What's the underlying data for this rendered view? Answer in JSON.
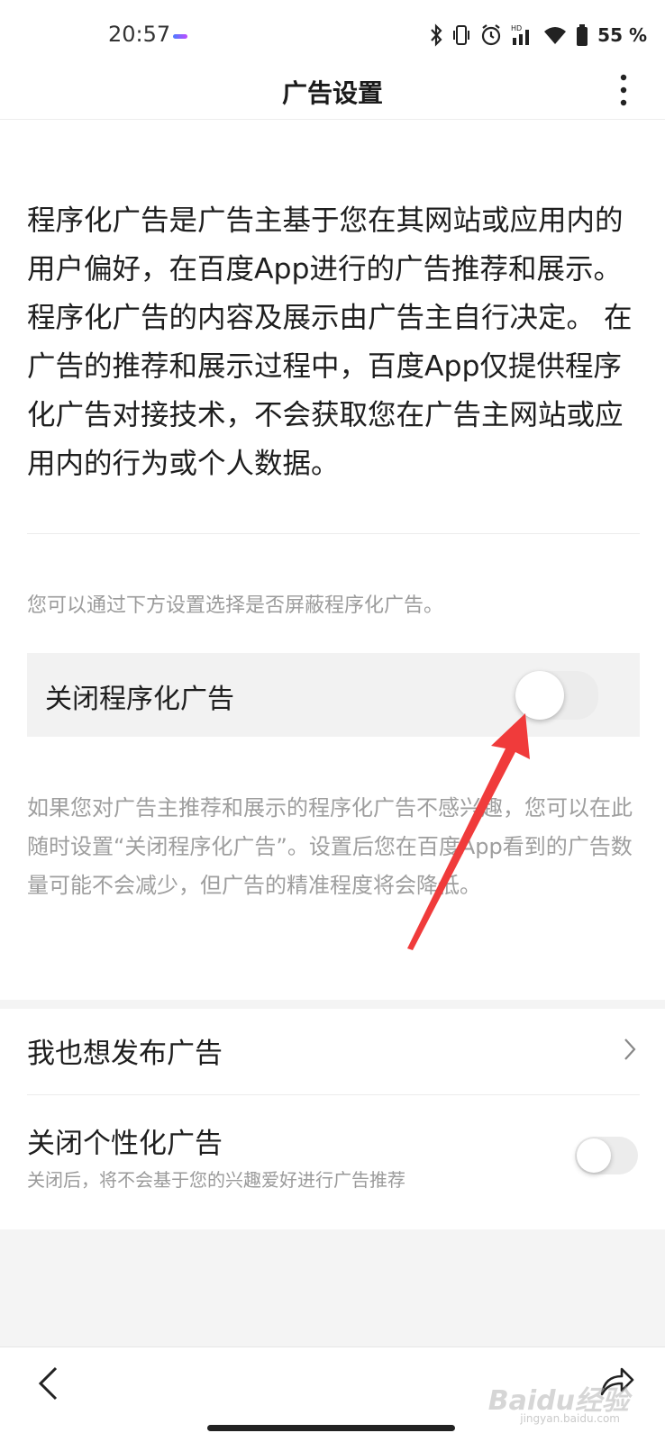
{
  "status_bar": {
    "time": "20:57",
    "battery": "55 %",
    "icons": [
      "bluetooth-icon",
      "vibrate-icon",
      "alarm-icon",
      "hd-signal-icon",
      "wifi-icon",
      "battery-icon"
    ]
  },
  "nav": {
    "title": "广告设置",
    "more_icon": "more-vertical-icon"
  },
  "intro_text": "程序化广告是广告主基于您在其网站或应用内的用户偏好，在百度App进行的广告推荐和展示。程序化广告的内容及展示由广告主自行决定。 在广告的推荐和展示过程中，百度App仅提供程序化广告对接技术，不会获取您在广告主网站或应用内的行为或个人数据。",
  "hint_text": "您可以通过下方设置选择是否屏蔽程序化广告。",
  "programmatic_toggle": {
    "label": "关闭程序化广告",
    "on": false
  },
  "description": "如果您对广告主推荐和展示的程序化广告不感兴趣，您可以在此随时设置“关闭程序化广告”。设置后您在百度App看到的广告数量可能不会减少，但广告的精准程度将会降低。",
  "list": {
    "publish_ads": {
      "label": "我也想发布广告",
      "icon": "chevron-right-icon"
    },
    "personalized_toggle": {
      "label": "关闭个性化广告",
      "sub": "关闭后，将不会基于您的兴趣爱好进行广告推荐",
      "on": false
    }
  },
  "bottom_bar": {
    "back_icon": "back-arrow-icon",
    "share_icon": "share-icon"
  },
  "watermark": {
    "text": "Baidu经验",
    "sub": "jingyan.baidu.com"
  },
  "annotation": {
    "color": "#f03b3b"
  }
}
